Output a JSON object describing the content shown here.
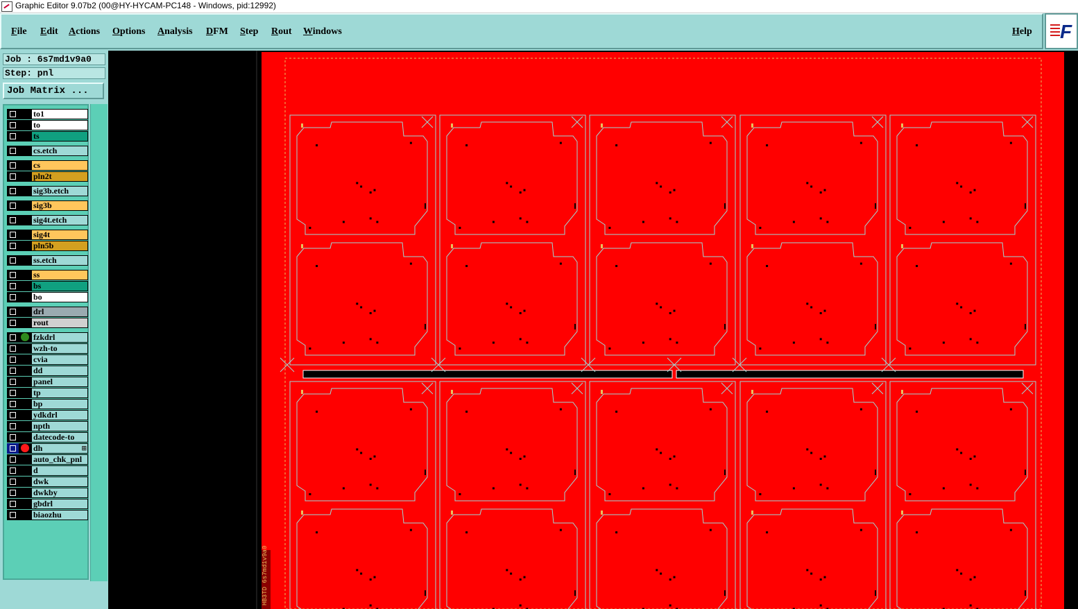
{
  "window": {
    "title": "Graphic Editor 9.07b2 (00@HY-HYCAM-PC148 - Windows, pid:12992)"
  },
  "menu": {
    "items": [
      "File",
      "Edit",
      "Actions",
      "Options",
      "Analysis",
      "DFM",
      "Step",
      "Rout",
      "Windows"
    ],
    "help": "Help"
  },
  "logo": {
    "text": "F",
    "icon": "frontline-logo-icon"
  },
  "job": {
    "job_label": "Job : 6s7md1v9a0",
    "step_label": "Step: pnl",
    "matrix_button": "Job Matrix ..."
  },
  "layers": [
    {
      "name": "to1",
      "color": "#ffffff",
      "group": 0
    },
    {
      "name": "to",
      "color": "#ffffff",
      "group": 0
    },
    {
      "name": "ts",
      "color": "#10a080",
      "group": 0
    },
    {
      "name": "cs.etch",
      "color": "#9ed9d6",
      "group": 1
    },
    {
      "name": "cs",
      "color": "#ffc65c",
      "group": 2
    },
    {
      "name": "pln2t",
      "color": "#d4a020",
      "group": 2
    },
    {
      "name": "sig3b.etch",
      "color": "#9ed9d6",
      "group": 3
    },
    {
      "name": "sig3b",
      "color": "#ffc65c",
      "group": 4
    },
    {
      "name": "sig4t.etch",
      "color": "#9ed9d6",
      "group": 5
    },
    {
      "name": "sig4t",
      "color": "#ffc65c",
      "group": 6
    },
    {
      "name": "pln5b",
      "color": "#d4a020",
      "group": 6
    },
    {
      "name": "ss.etch",
      "color": "#9ed9d6",
      "group": 7
    },
    {
      "name": "ss",
      "color": "#ffc65c",
      "group": 8
    },
    {
      "name": "bs",
      "color": "#10a080",
      "group": 8
    },
    {
      "name": "bo",
      "color": "#ffffff",
      "group": 8
    },
    {
      "name": "drl",
      "color": "#9aaab0",
      "group": 9
    },
    {
      "name": "rout",
      "color": "#d0d0d0",
      "group": 9
    },
    {
      "name": "fzkdrl",
      "color": "#9ed9d6",
      "group": 10,
      "dot": "#2e8b1e"
    },
    {
      "name": "wzh-to",
      "color": "#9ed9d6",
      "group": 10
    },
    {
      "name": "cvia",
      "color": "#9ed9d6",
      "group": 10
    },
    {
      "name": "dd",
      "color": "#9ed9d6",
      "group": 10
    },
    {
      "name": "panel",
      "color": "#9ed9d6",
      "group": 10
    },
    {
      "name": "tp",
      "color": "#9ed9d6",
      "group": 10
    },
    {
      "name": "bp",
      "color": "#9ed9d6",
      "group": 10
    },
    {
      "name": "ydkdrl",
      "color": "#9ed9d6",
      "group": 10
    },
    {
      "name": "npth",
      "color": "#9ed9d6",
      "group": 10
    },
    {
      "name": "datecode-to",
      "color": "#9ed9d6",
      "group": 10
    },
    {
      "name": "dh",
      "color": "#9ed9d6",
      "group": 10,
      "dot": "#ff1a1a",
      "active": true
    },
    {
      "name": "auto_chk_pnl",
      "color": "#9ed9d6",
      "group": 10
    },
    {
      "name": "d",
      "color": "#9ed9d6",
      "group": 10
    },
    {
      "name": "dwk",
      "color": "#9ed9d6",
      "group": 10
    },
    {
      "name": "dwkby",
      "color": "#9ed9d6",
      "group": 10
    },
    {
      "name": "gbdrl",
      "color": "#9ed9d6",
      "group": 10
    },
    {
      "name": "biaozhu",
      "color": "#9ed9d6",
      "group": 10
    }
  ],
  "canvas": {
    "background": "#000000",
    "panel_color": "#ff0000",
    "outline_color": "#9ed9d6",
    "unit_columns": 5,
    "unit_rows": 4,
    "side_text": "HB3TD 6s7md1v9a0"
  }
}
